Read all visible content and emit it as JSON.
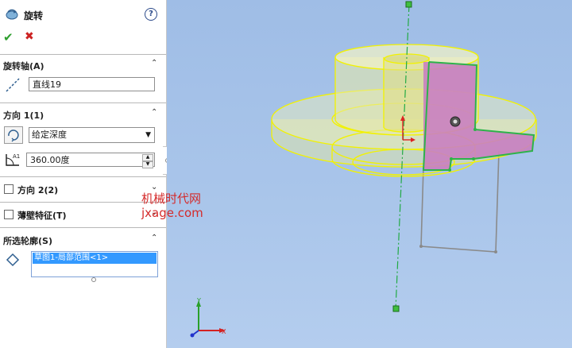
{
  "header": {
    "title": "旋转"
  },
  "icons": {
    "feature": "revolve-icon",
    "help": "help-icon",
    "ok": "checkmark-icon",
    "cancel": "close-icon",
    "axis": "line-axis-icon",
    "reverse": "reverse-direction-icon",
    "angle": "angle-icon",
    "profile": "sketch-profile-icon"
  },
  "glyphs": {
    "help": "?",
    "ok": "✔",
    "cancel": "✖",
    "collapse_up": "⌃",
    "collapse_down": "⌄",
    "dropdown": "▼"
  },
  "axis_section": {
    "title": "旋转轴(A)",
    "value": "直线19"
  },
  "direction1": {
    "title": "方向 1(1)",
    "end_condition": "给定深度",
    "angle": "360.00度"
  },
  "direction2": {
    "title": "方向 2(2)",
    "checked": false
  },
  "thin_feature": {
    "title": "薄壁特征(T)",
    "checked": false
  },
  "profile_section": {
    "title": "所选轮廓(S)",
    "items": [
      "草图1-局部范围<1>"
    ]
  },
  "watermark": {
    "line1": "机械时代网",
    "line2": "jxage.com"
  },
  "triad": {
    "x": "X",
    "y": "Y"
  },
  "colors": {
    "viewport_bg": "#a9c5ea",
    "model_edge": "#f2f200",
    "sketch_green": "#2db34a",
    "cut_face": "#c97fc0",
    "axis_line": "#22aa44",
    "watermark": "#d42a2a"
  }
}
